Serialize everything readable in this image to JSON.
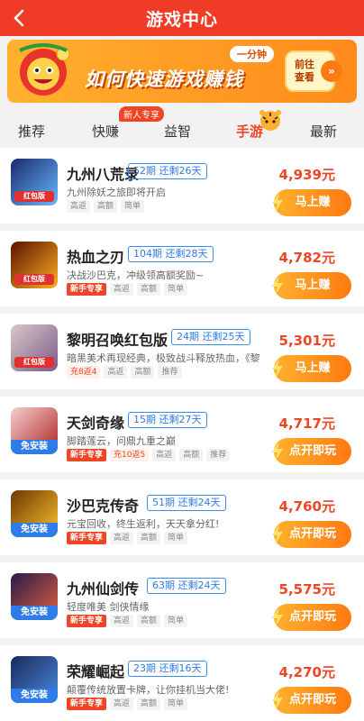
{
  "header": {
    "title": "游戏中心"
  },
  "banner": {
    "text": "如何快速游戏赚钱",
    "tag": "一分钟",
    "cta": [
      "前往",
      "查看"
    ]
  },
  "tabs": [
    {
      "label": "推荐",
      "active": false
    },
    {
      "label": "快赚",
      "active": false,
      "badge": "新人专享"
    },
    {
      "label": "益智",
      "active": false
    },
    {
      "label": "手游",
      "active": true
    },
    {
      "label": "最新",
      "active": false
    }
  ],
  "games": [
    {
      "name": "九州八荒录",
      "period": "52期 还剩26天",
      "desc": "九州除妖之旅即将开启",
      "tags": [
        "高返",
        "高额",
        "简单"
      ],
      "reward": "4,939元",
      "button": "马上赚",
      "icon_label": "红包版",
      "icon_colors": [
        "#1a2a6c",
        "#6bb8ff"
      ]
    },
    {
      "name": "热血之刃",
      "period": "104期 还剩28天",
      "desc": "决战沙巴克，冲级领高额奖励~",
      "tags": [
        "新手专享",
        "高返",
        "高额",
        "简单"
      ],
      "reward": "4,782元",
      "button": "马上赚",
      "icon_label": "红包版",
      "icon_colors": [
        "#5a1200",
        "#ffb020"
      ]
    },
    {
      "name": "黎明召唤红包版",
      "period": "24期 还剩25天",
      "desc": "暗黑美术再现经典，极致战斗释放热血，《黎",
      "tags": [
        "充8返4",
        "高返",
        "高额",
        "推荐"
      ],
      "reward": "5,301元",
      "button": "马上赚",
      "icon_label": "红包版",
      "icon_colors": [
        "#d8c8c8",
        "#7a5a8a"
      ]
    },
    {
      "name": "天剑奇缘",
      "period": "15期 还剩27天",
      "desc": "脚踏莲云，问鼎九重之巅",
      "tags": [
        "新手专享",
        "充10返5",
        "高返",
        "高额",
        "推荐"
      ],
      "reward": "4,717元",
      "button": "点开即玩",
      "icon_label": "免安装",
      "icon_colors": [
        "#f4d0d0",
        "#b02020"
      ]
    },
    {
      "name": "沙巴克传奇",
      "period": "51期 还剩24天",
      "desc": "元宝回收，终生返利，天天拿分红!",
      "tags": [
        "新手专享",
        "高返",
        "高额",
        "简单"
      ],
      "reward": "4,760元",
      "button": "点开即玩",
      "icon_label": "免安装",
      "icon_colors": [
        "#6a3a00",
        "#ffc030"
      ]
    },
    {
      "name": "九州仙剑传",
      "period": "63期 还剩24天",
      "desc": "轻度唯美 剑侠情缘",
      "tags": [
        "新手专享",
        "高返",
        "高额",
        "简单"
      ],
      "reward": "5,575元",
      "button": "点开即玩",
      "icon_label": "免安装",
      "icon_colors": [
        "#2a1a4a",
        "#e06040"
      ]
    },
    {
      "name": "荣耀崛起",
      "period": "23期 还剩16天",
      "desc": "颠覆传统放置卡牌，让你挂机当大佬!",
      "tags": [
        "新手专享",
        "高返",
        "高额",
        "简单"
      ],
      "reward": "4,270元",
      "button": "点开即玩",
      "icon_label": "免安装",
      "icon_colors": [
        "#1a2a5a",
        "#4a8ae0"
      ]
    }
  ],
  "colors": {
    "brand": "#f03b26",
    "accent": "#ff7a12",
    "link": "#2f7ce8"
  }
}
